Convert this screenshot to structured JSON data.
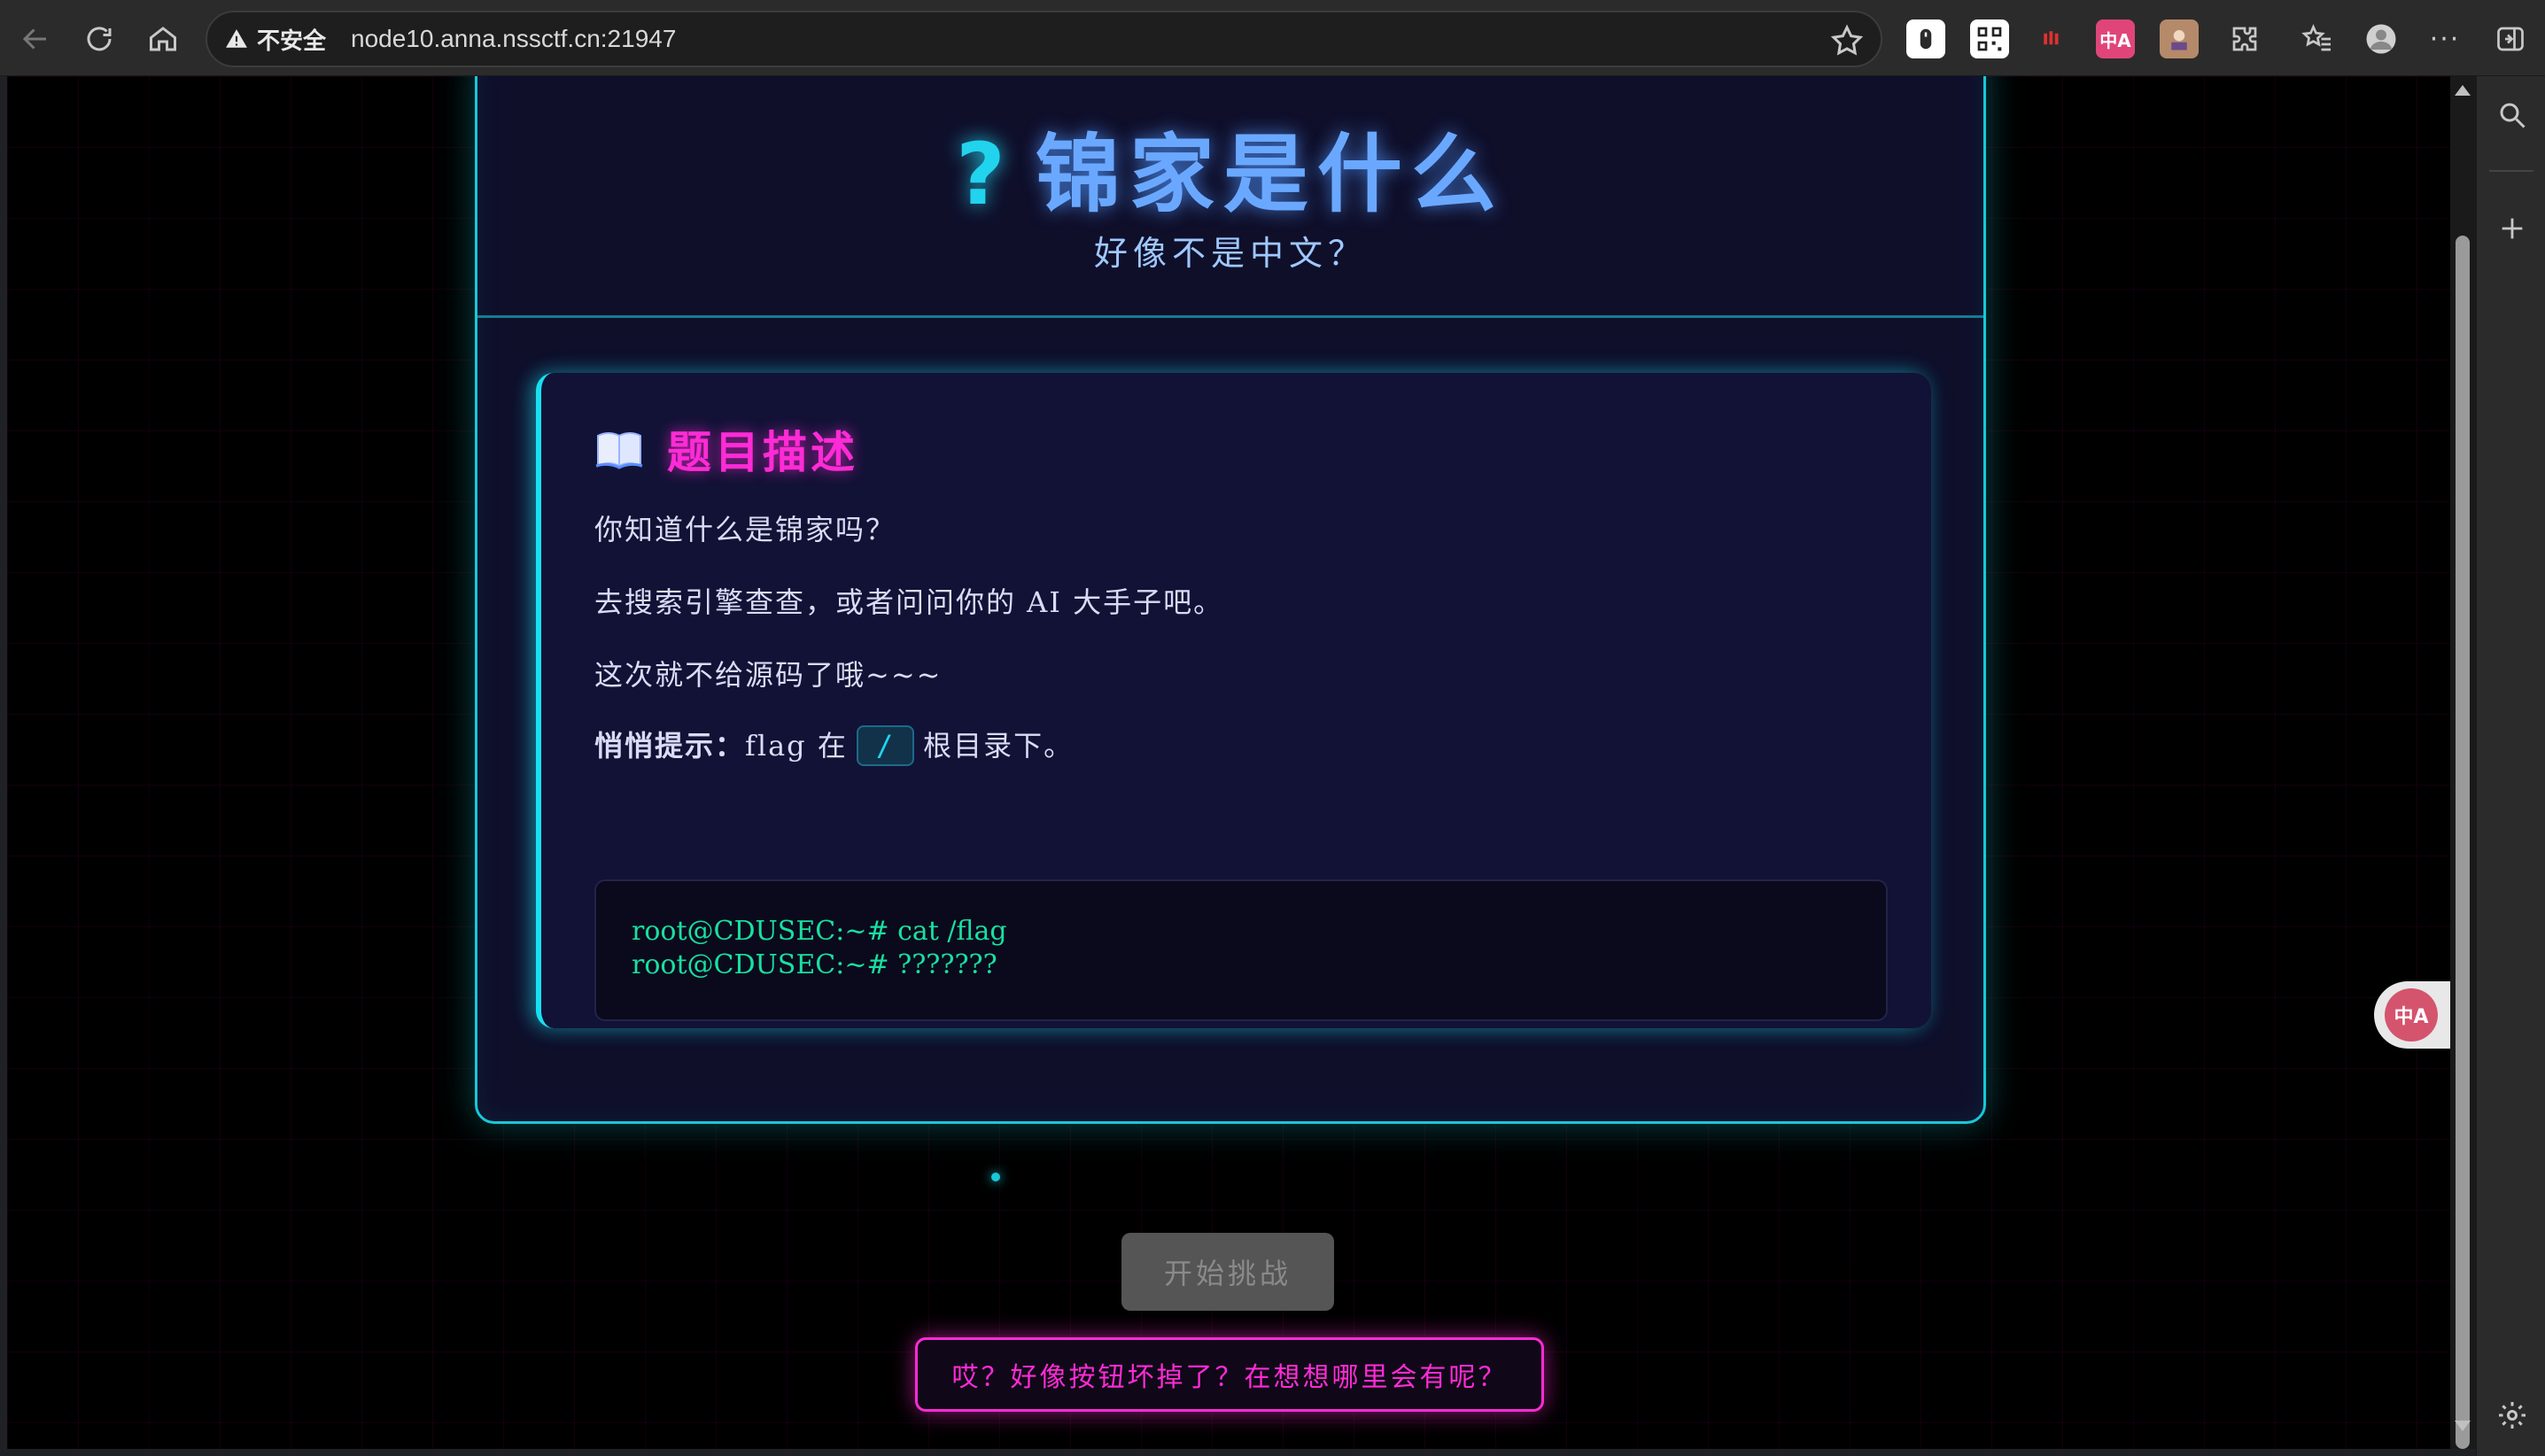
{
  "browser": {
    "security_label": "不安全",
    "url": "node10.anna.nssctf.cn:21947",
    "extension_translate_label": "中A"
  },
  "page": {
    "title_icon": "?",
    "title": "锦家是什么",
    "subtitle": "好像不是中文？",
    "description": {
      "heading": "题目描述",
      "line1": "你知道什么是锦家吗？",
      "line2": "去搜索引擎查查，或者问问你的 AI 大手子吧。",
      "line3": "这次就不给源码了哦~~~",
      "hint_label": "悄悄提示：",
      "hint_text_before": "flag 在",
      "hint_code": "/",
      "hint_text_after": "根目录下。",
      "terminal_line1": "root@CDUSEC:~# cat /flag",
      "terminal_line2": "root@CDUSEC:~# ???????"
    },
    "start_button": "开始挑战",
    "hint_button": "哎？好像按钮坏掉了？在想想哪里会有呢？"
  },
  "colors": {
    "cyan": "#18c8d8",
    "magenta": "#ff2bd6",
    "title_blue": "#6aa8ff",
    "terminal_green": "#19e0a0"
  }
}
